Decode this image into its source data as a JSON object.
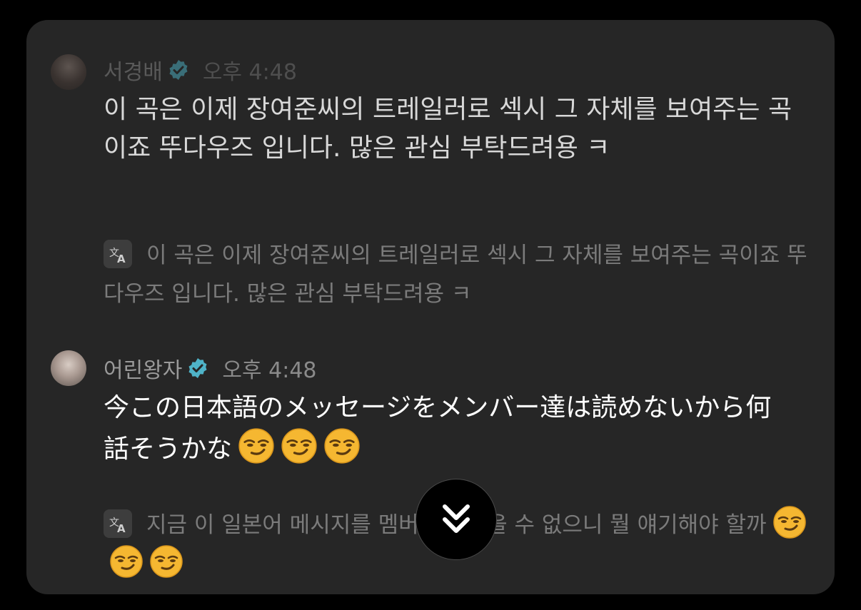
{
  "messages": [
    {
      "author": "서경배",
      "verified": true,
      "time": "오후 4:48",
      "text": "이 곡은 이제 장여준씨의 트레일러로 섹시 그 자체를 보여주는 곡이죠 뚜다우즈 입니다. 많은 관심 부탁드려용 ㅋ",
      "translation": "이 곡은 이제 장여준씨의 트레일러로 섹시 그 자체를 보여주는 곡이죠 뚜다우즈 입니다. 많은 관심 부탁드려용 ㅋ"
    },
    {
      "author": "어린왕자",
      "verified": true,
      "time": "오후 4:48",
      "text": "今この日本語のメッセージをメンバー達は読めないから何話そうかな",
      "emoji_count": 3,
      "translation": "지금 이 일본어 메시지를 멤버들이 읽을 수 없으니 뭘 얘기해야 할까",
      "translation_emoji_count": 3
    }
  ],
  "icons": {
    "verified": "verified-badge-icon",
    "translate": "translate-icon",
    "emoji": "smirking-face-emoji",
    "scroll": "chevron-double-down-icon"
  },
  "colors": {
    "card_bg": "#262626",
    "verified": "#4fb3c8",
    "emoji": "#f5b731"
  }
}
